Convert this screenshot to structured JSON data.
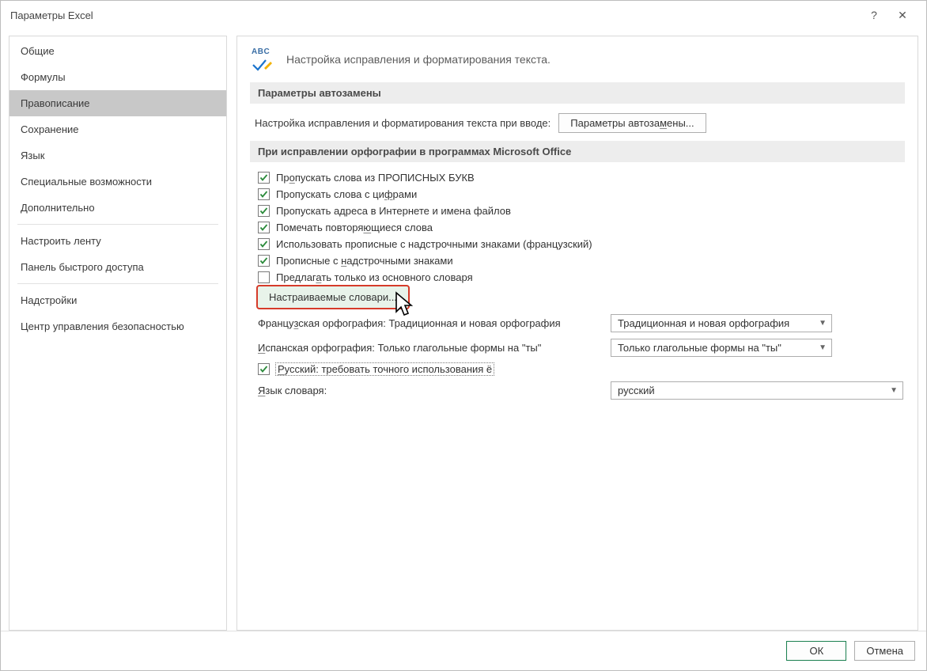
{
  "window": {
    "title": "Параметры Excel"
  },
  "sidebar": {
    "items": [
      "Общие",
      "Формулы",
      "Правописание",
      "Сохранение",
      "Язык",
      "Специальные возможности",
      "Дополнительно"
    ],
    "items2": [
      "Настроить ленту",
      "Панель быстрого доступа"
    ],
    "items3": [
      "Надстройки",
      "Центр управления безопасностью"
    ],
    "selected": "Правописание"
  },
  "intro": {
    "abc": "ABC",
    "text": "Настройка исправления и форматирования текста."
  },
  "section1": {
    "title": "Параметры автозамены",
    "label": "Настройка исправления и форматирования текста при вводе:",
    "button": "Параметры автозамены..."
  },
  "section2": {
    "title": "При исправлении орфографии в программах Microsoft Office",
    "checks": [
      {
        "checked": true,
        "pre": "Пр",
        "u": "о",
        "post": "пускать слова из ПРОПИСНЫХ БУКВ"
      },
      {
        "checked": true,
        "pre": "Пропускать слова с ци",
        "u": "ф",
        "post": "рами"
      },
      {
        "checked": true,
        "pre": "Пропускать адреса в Интернете и имена файлов",
        "u": "",
        "post": ""
      },
      {
        "checked": true,
        "pre": "Помечать повторя",
        "u": "ю",
        "post": "щиеся слова"
      },
      {
        "checked": true,
        "pre": "Использовать прописные с надстрочными знаками (французский)",
        "u": "",
        "post": ""
      },
      {
        "checked": true,
        "pre": "Прописные с ",
        "u": "н",
        "post": "адстрочными знаками"
      },
      {
        "checked": false,
        "pre": "Предлаг",
        "u": "а",
        "post": "ть только из основного словаря"
      }
    ],
    "customDict": "Настраиваемые словари...",
    "rows": [
      {
        "labelPre": "Францу",
        "labelU": "з",
        "labelPost": "ская орфография: Традиционная и новая орфография",
        "value": "Традиционная и новая орфография"
      },
      {
        "labelPre": "",
        "labelU": "И",
        "labelPost": "спанская орфография: Только глагольные формы на \"ты\"",
        "value": "Только глагольные формы на \"ты\""
      }
    ],
    "ru": {
      "checked": true,
      "pre": "",
      "u": "Р",
      "post": "усский: требовать точного использования ё"
    },
    "dictLang": {
      "labelPre": "",
      "labelU": "Я",
      "labelPost": "зык словаря:",
      "value": "русский"
    }
  },
  "footer": {
    "ok": "ОК",
    "cancel": "Отмена"
  }
}
